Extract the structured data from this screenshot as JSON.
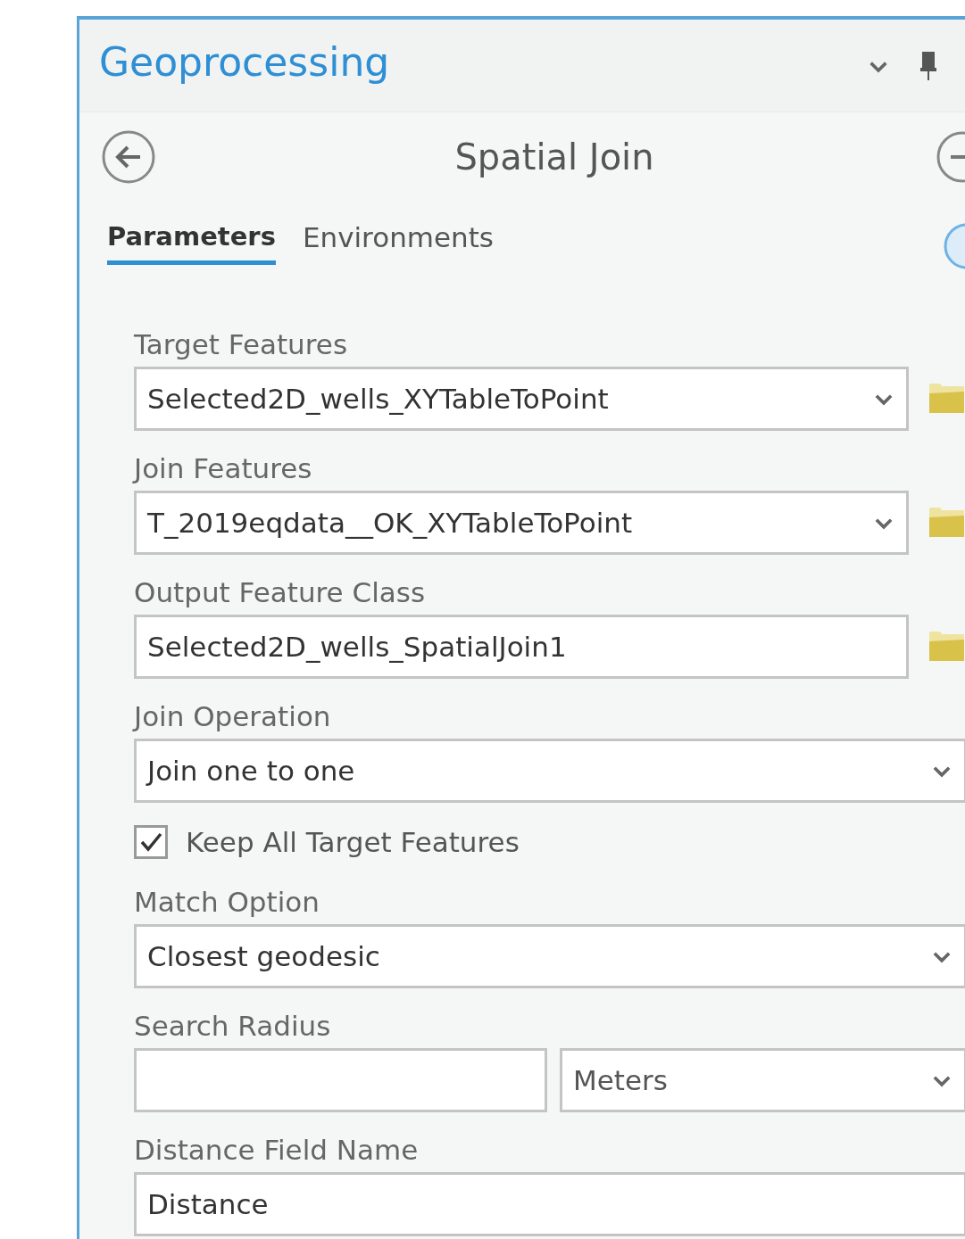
{
  "pane": {
    "title": "Geoprocessing"
  },
  "tool": {
    "title": "Spatial Join"
  },
  "tabs": [
    {
      "label": "Parameters",
      "selected": true
    },
    {
      "label": "Environments",
      "selected": false
    }
  ],
  "parameters": [
    {
      "kind": "dropdown",
      "label": "Target Features",
      "value": "Selected2D_wells_XYTableToPoint",
      "browse": true
    },
    {
      "kind": "dropdown",
      "label": "Join Features",
      "value": "T_2019eqdata__OK_XYTableToPoint",
      "browse": true
    },
    {
      "kind": "text",
      "label": "Output Feature Class",
      "value": "Selected2D_wells_SpatialJoin1",
      "browse": true
    },
    {
      "kind": "dropdown",
      "label": "Join Operation",
      "value": "Join one to one",
      "browse": false
    },
    {
      "kind": "checkbox",
      "label": "Keep All Target Features",
      "checked": true
    },
    {
      "kind": "dropdown",
      "label": "Match Option",
      "value": "Closest geodesic",
      "browse": false
    },
    {
      "kind": "linear_unit",
      "label": "Search Radius",
      "unit": "Meters"
    },
    {
      "kind": "text",
      "label": "Distance Field Name",
      "value": "Distance",
      "browse": false
    }
  ]
}
